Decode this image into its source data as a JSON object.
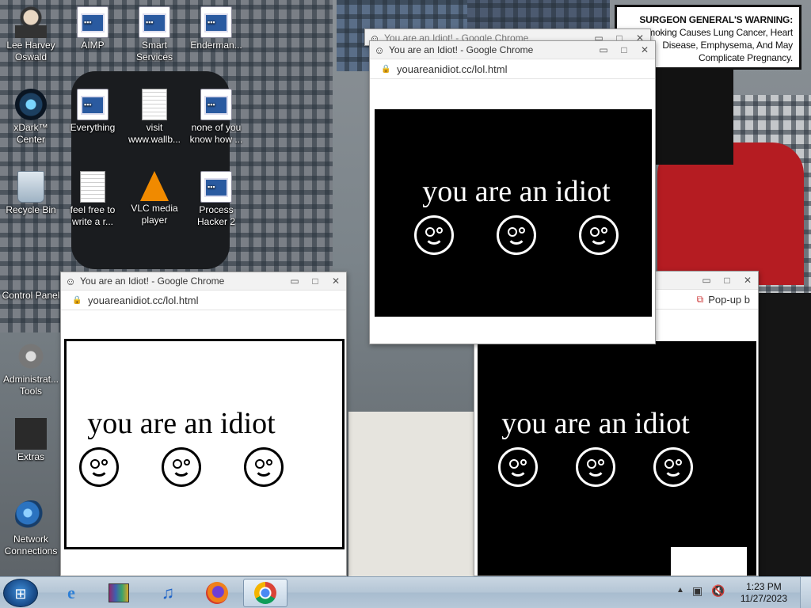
{
  "warning": {
    "heading": "SURGEON GENERAL'S WARNING:",
    "text": "Smoking Causes Lung Cancer, Heart Disease, Emphysema, And May Complicate Pregnancy."
  },
  "desktop_icons": [
    {
      "label": "Lee Harvey Oswald",
      "icon": "person-icon"
    },
    {
      "label": "AIMP",
      "icon": "app-icon"
    },
    {
      "label": "Smart Services",
      "icon": "gear-icon"
    },
    {
      "label": "Enderman...",
      "icon": "app-icon"
    },
    {
      "label": "xDark™ Center",
      "icon": "speaker-icon"
    },
    {
      "label": "Everything",
      "icon": "app-icon"
    },
    {
      "label": "visit www.wallb...",
      "icon": "document-icon"
    },
    {
      "label": "none of you know how ...",
      "icon": "app-icon"
    },
    {
      "label": "Recycle Bin",
      "icon": "recycle-bin-icon"
    },
    {
      "label": "feel free to write a r...",
      "icon": "document-icon"
    },
    {
      "label": "VLC media player",
      "icon": "vlc-icon"
    },
    {
      "label": "Process Hacker 2",
      "icon": "app-icon"
    },
    {
      "label": "Control Panel",
      "icon": "control-panel-icon"
    },
    {
      "label": "Administrat... Tools",
      "icon": "tools-icon"
    },
    {
      "label": "Extras",
      "icon": "folder-icon"
    },
    {
      "label": "Network Connections",
      "icon": "network-icon"
    }
  ],
  "windows": [
    {
      "title": "You are an Idiot! - Google Chrome",
      "url": "youareanidiot.cc/lol.html",
      "text": "you are an idiot"
    },
    {
      "title": "You are an Idiot! - Google Chrome",
      "url": "youareanidiot.cc/lol.html",
      "text": "you are an idiot"
    },
    {
      "title": "You are an Idiot! - Google Chrome",
      "url": "youareanidiot.cc/lol.html",
      "text": "you are an idiot"
    },
    {
      "title": "",
      "url": "",
      "text": "you are an idiot",
      "popup_label": "Pop-up b"
    }
  ],
  "window_controls": {
    "minimize": "▭",
    "maximize": "□",
    "close": "✕"
  },
  "taskbar": {
    "start_icon": "windows-logo",
    "pinned": [
      "internet-explorer-icon",
      "winrar-icon",
      "music-icon",
      "firefox-icon",
      "chrome-icon"
    ],
    "clock_time": "1:23 PM",
    "clock_date": "11/27/2023",
    "tray_icons": [
      "chevron-up-icon",
      "network-icon",
      "volume-muted-icon"
    ]
  },
  "colors": {
    "taskbar": "#b5c6d6",
    "page_black": "#000000",
    "page_white": "#ffffff"
  }
}
